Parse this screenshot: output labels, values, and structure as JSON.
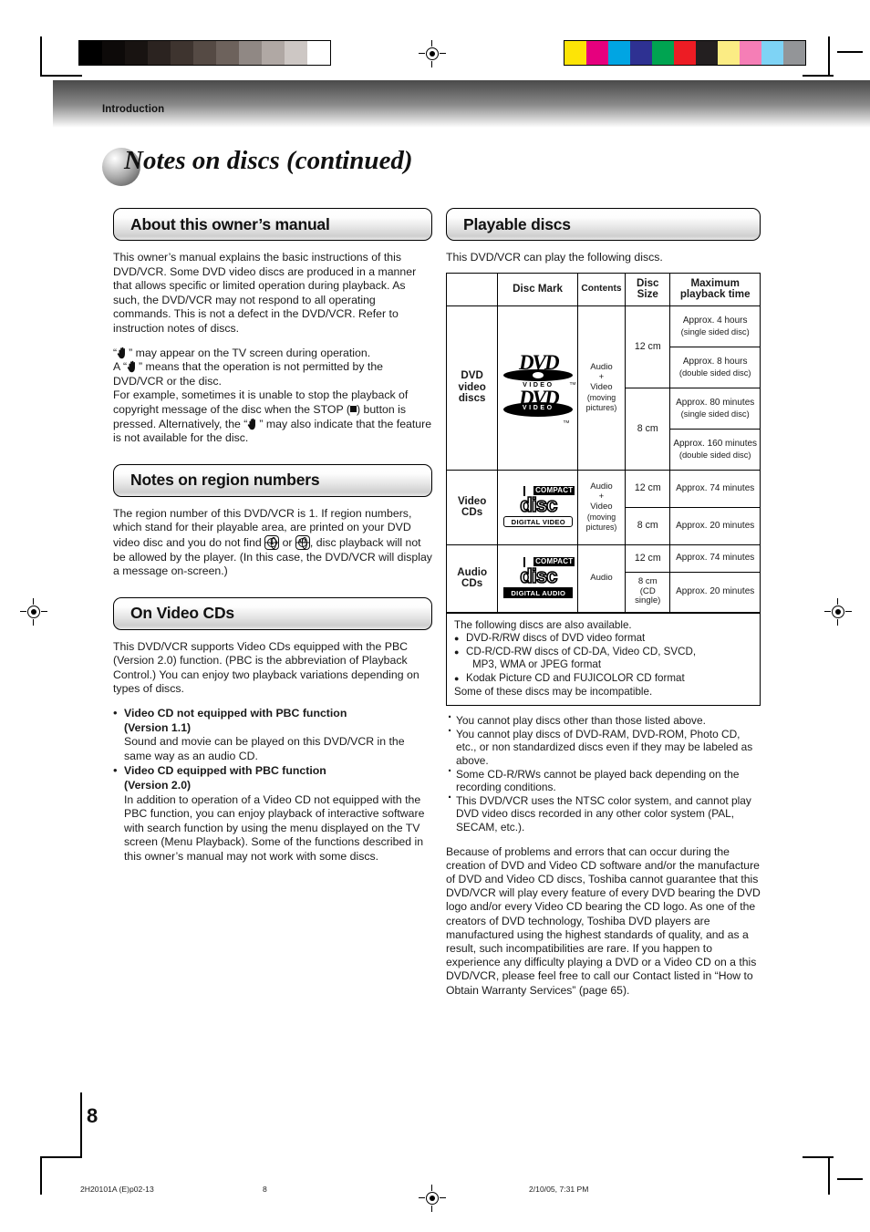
{
  "header": {
    "section_label": "Introduction"
  },
  "title": {
    "text": "Notes on discs (continued)"
  },
  "left": {
    "about": {
      "heading": "About this owner’s manual",
      "p1": "This owner’s manual explains the basic instructions of this DVD/VCR. Some DVD video discs are produced in a manner that allows specific or limited operation during playback. As such, the DVD/VCR may not respond to all operating commands. This is not a defect in the DVD/VCR. Refer to instruction notes of discs.",
      "p2_a": "“",
      "p2_b": "” may appear on the TV screen during operation.",
      "p2_c": "A “",
      "p2_d": "” means that the operation is not permitted by the DVD/VCR or the disc.",
      "p2_e": "For example, sometimes it is unable to stop the playback of copyright message of the disc when the STOP (",
      "p2_f": ") button is pressed. Alternatively, the “",
      "p2_g": "” may also indicate that the feature is not available for the disc."
    },
    "region": {
      "heading": "Notes on region numbers",
      "p1_a": "The region number of this DVD/VCR is 1. If region numbers, which stand for their playable area, are printed on your DVD video disc and you do not find",
      "p1_b": "or",
      "p1_c": ", disc playback will not be allowed by the player. (In this case, the DVD/VCR will display a message on-screen.)",
      "badge1": "1",
      "badge2": "ALL"
    },
    "videocd": {
      "heading": "On Video CDs",
      "p1": "This DVD/VCR supports Video CDs equipped with the PBC (Version 2.0) function. (PBC is the abbreviation of Playback Control.) You can enjoy two playback variations depending on types of discs.",
      "items": [
        {
          "title": "Video CD not equipped with PBC function",
          "subtitle": "(Version 1.1)",
          "body": "Sound and movie can be played on this DVD/VCR in the same way as an audio CD."
        },
        {
          "title": "Video CD equipped with PBC function",
          "subtitle": "(Version 2.0)",
          "body": "In addition to operation of a Video CD not equipped with the PBC function, you can enjoy playback of interactive software with search function by using the menu displayed on the TV screen (Menu Playback). Some of the functions described in this owner’s manual may not work with some discs."
        }
      ]
    }
  },
  "right": {
    "playable": {
      "heading": "Playable discs",
      "intro": "This DVD/VCR can play the following discs."
    },
    "table": {
      "headers": [
        "",
        "Disc Mark",
        "Contents",
        "Disc Size",
        "Maximum playback time"
      ],
      "rows": [
        {
          "category": "DVD video discs",
          "logos": [
            "dvd-video-logo",
            "dvd-video-logo-inverse"
          ],
          "contents": "Audio + Video (moving pictures)",
          "contents_l1": "Audio",
          "contents_l2": "+",
          "contents_l3": "Video",
          "contents_l4": "(moving",
          "contents_l5": "pictures)",
          "sizes": [
            {
              "size": "12 cm",
              "times": [
                {
                  "l1": "Approx. 4 hours",
                  "l2": "(single sided disc)"
                },
                {
                  "l1": "Approx. 8 hours",
                  "l2": "(double sided disc)"
                }
              ]
            },
            {
              "size": "8 cm",
              "times": [
                {
                  "l1": "Approx. 80 minutes",
                  "l2": "(single sided disc)"
                },
                {
                  "l1": "Approx. 160 minutes",
                  "l2": "(double sided disc)"
                }
              ]
            }
          ]
        },
        {
          "category": "Video CDs",
          "logo": "compact-disc-digital-video-logo",
          "logo_top": "COMPACT",
          "logo_main": "disc",
          "logo_sub": "DIGITAL VIDEO",
          "contents_l1": "Audio",
          "contents_l2": "+",
          "contents_l3": "Video",
          "contents_l4": "(moving",
          "contents_l5": "pictures)",
          "sizes": [
            {
              "size": "12 cm",
              "times": [
                {
                  "l1": "Approx. 74 minutes",
                  "l2": ""
                }
              ]
            },
            {
              "size": "8 cm",
              "times": [
                {
                  "l1": "Approx. 20 minutes",
                  "l2": ""
                }
              ]
            }
          ]
        },
        {
          "category": "Audio CDs",
          "logo": "compact-disc-digital-audio-logo",
          "logo_top": "COMPACT",
          "logo_main": "disc",
          "logo_sub": "DIGITAL AUDIO",
          "contents_l1": "Audio",
          "sizes": [
            {
              "size": "12 cm",
              "times": [
                {
                  "l1": "Approx. 74 minutes",
                  "l2": ""
                }
              ]
            },
            {
              "size": "8 cm (CD single)",
              "size_l1": "8 cm",
              "size_l2": "(CD",
              "size_l3": "single)",
              "times": [
                {
                  "l1": "Approx. 20 minutes",
                  "l2": ""
                }
              ]
            }
          ]
        }
      ]
    },
    "also_box": {
      "intro": "The following discs are also available.",
      "items": [
        {
          "l1": "DVD-R/RW discs of DVD video format",
          "l2": ""
        },
        {
          "l1": "CD-R/CD-RW discs of CD-DA, Video CD, SVCD,",
          "l2": "MP3, WMA or JPEG format"
        },
        {
          "l1": "Kodak Picture CD and FUJICOLOR CD format",
          "l2": ""
        }
      ],
      "outro": "Some of these discs may be incompatible."
    },
    "notes": [
      "You cannot play discs other than those listed above.",
      "You cannot play discs of DVD-RAM, DVD-ROM, Photo CD, etc., or non standardized discs even if they may be labeled as above.",
      "Some CD-R/RWs cannot be played back depending on the recording conditions.",
      "This DVD/VCR uses the NTSC color system, and cannot play DVD video discs recorded in any other color system (PAL, SECAM, etc.)."
    ],
    "closing": "Because of problems and errors that can occur during the creation of DVD and Video CD software and/or the manufacture of DVD and Video CD discs, Toshiba cannot guarantee that this DVD/VCR will play every feature of every DVD bearing the DVD logo and/or every Video CD bearing the CD logo. As one of the creators of DVD technology, Toshiba DVD players are manufactured using the highest standards of quality, and as a result, such incompatibilities are rare. If you happen to experience any difficulty playing a DVD or a Video CD on a this DVD/VCR, please feel free to call our Contact listed in “How to Obtain Warranty Services” (page 65)."
  },
  "page_number": "8",
  "footer": {
    "left": "2H20101A (E)p02-13",
    "middle": "8",
    "right": "2/10/05, 7:31 PM"
  },
  "print_bars": {
    "gray_steps": [
      "#000000",
      "#0d0a09",
      "#181311",
      "#2b2320",
      "#3e342f",
      "#554a44",
      "#6d625c",
      "#908884",
      "#b0a8a4",
      "#cdc7c4",
      "#ffffff"
    ],
    "colors": [
      "#fde406",
      "#e6007e",
      "#00a5e3",
      "#2e3192",
      "#00a451",
      "#ed1c24",
      "#231f20",
      "#fbec84",
      "#f57eb6",
      "#7ed3f5",
      "#939598"
    ]
  }
}
